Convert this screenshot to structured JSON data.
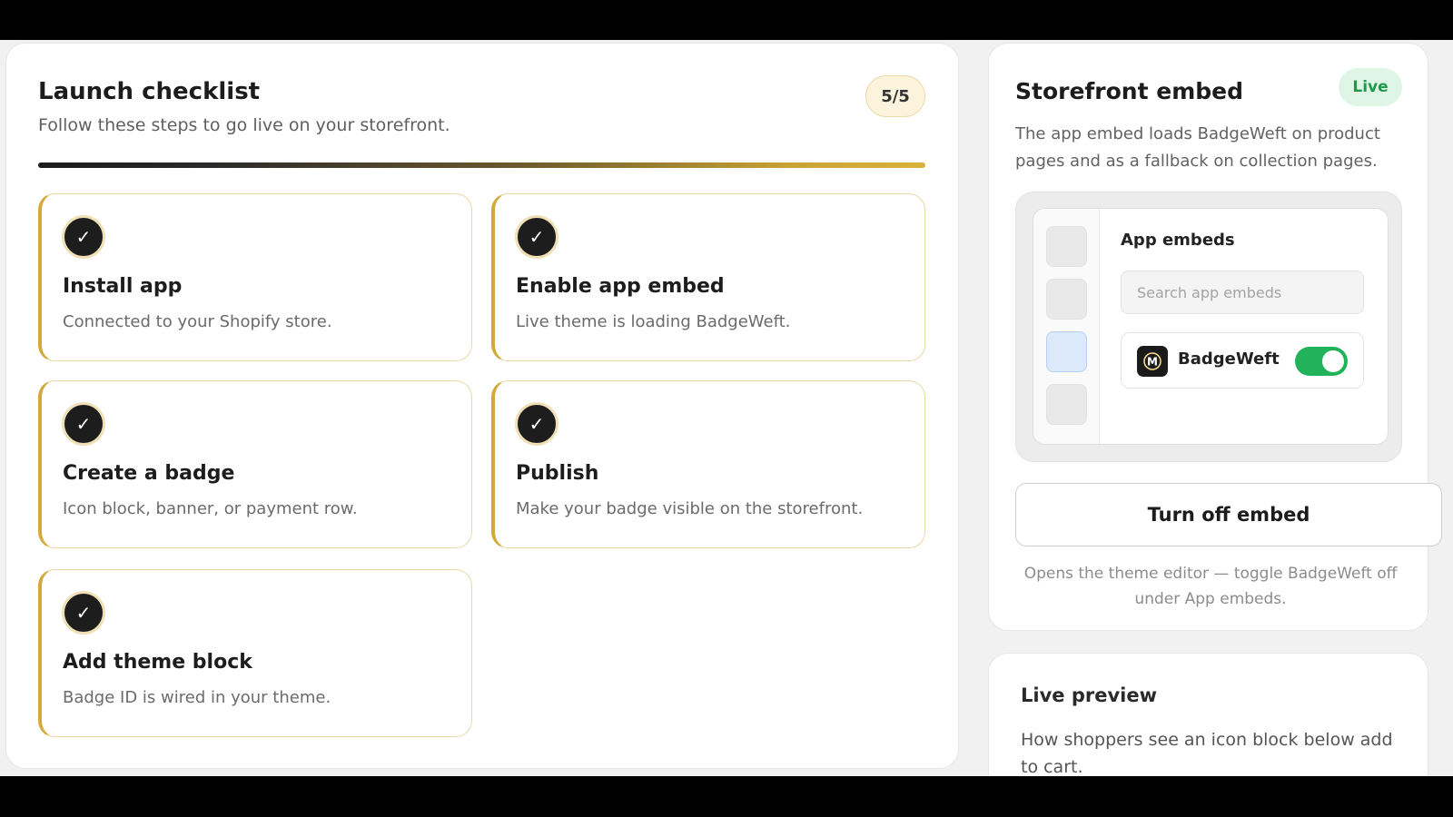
{
  "checklist": {
    "title": "Launch checklist",
    "subtitle": "Follow these steps to go live on your storefront.",
    "count": "5/5",
    "progress_percent": 100,
    "steps": [
      {
        "title": "Install app",
        "description": "Connected to your Shopify store.",
        "done": true
      },
      {
        "title": "Enable app embed",
        "description": "Live theme is loading BadgeWeft.",
        "done": true
      },
      {
        "title": "Create a badge",
        "description": "Icon block, banner, or payment row.",
        "done": true
      },
      {
        "title": "Publish",
        "description": "Make your badge visible on the storefront.",
        "done": true
      },
      {
        "title": "Add theme block",
        "description": "Badge ID is wired in your theme.",
        "done": true
      }
    ],
    "check_icon": "checkmark-icon"
  },
  "embed": {
    "title": "Storefront embed",
    "status": "Live",
    "description": "The app embed loads BadgeWeft on product pages and as a fallback on collection pages.",
    "mock": {
      "heading": "App embeds",
      "search_placeholder": "Search app embeds",
      "app_name": "BadgeWeft",
      "app_logo_letter": "M",
      "toggle_on": true
    },
    "button_label": "Turn off embed",
    "helper": "Opens the theme editor — toggle BadgeWeft off under App embeds."
  },
  "preview": {
    "title": "Live preview",
    "description": "How shoppers see an icon block below add to cart."
  },
  "colors": {
    "accent_gold": "#d2a93a",
    "live_green": "#1f9a4c",
    "toggle_green": "#22b35a"
  }
}
